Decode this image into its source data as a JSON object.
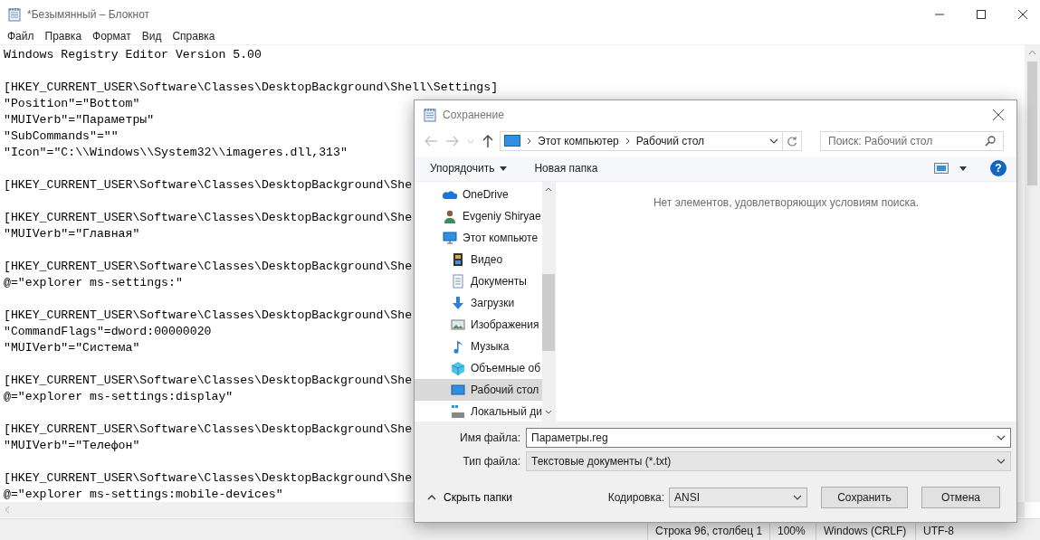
{
  "notepad": {
    "title": "*Безымянный – Блокнот",
    "menu": [
      "Файл",
      "Правка",
      "Формат",
      "Вид",
      "Справка"
    ],
    "blocks": [
      [
        "Windows Registry Editor Version 5.00"
      ],
      [
        "[HKEY_CURRENT_USER\\Software\\Classes\\DesktopBackground\\Shell\\Settings]",
        "\"Position\"=\"Bottom\"",
        "\"MUIVerb\"=\"Параметры\"",
        "\"SubCommands\"=\"\"",
        "\"Icon\"=\"C:\\\\Windows\\\\System32\\\\imageres.dll,313\""
      ],
      [
        "[HKEY_CURRENT_USER\\Software\\Classes\\DesktopBackground\\She"
      ],
      [
        "[HKEY_CURRENT_USER\\Software\\Classes\\DesktopBackground\\She",
        "\"MUIVerb\"=\"Главная\""
      ],
      [
        "[HKEY_CURRENT_USER\\Software\\Classes\\DesktopBackground\\She",
        "@=\"explorer ms-settings:\""
      ],
      [
        "[HKEY_CURRENT_USER\\Software\\Classes\\DesktopBackground\\She",
        "\"CommandFlags\"=dword:00000020",
        "\"MUIVerb\"=\"Система\""
      ],
      [
        "[HKEY_CURRENT_USER\\Software\\Classes\\DesktopBackground\\She",
        "@=\"explorer ms-settings:display\""
      ],
      [
        "[HKEY_CURRENT_USER\\Software\\Classes\\DesktopBackground\\She",
        "\"MUIVerb\"=\"Телефон\""
      ],
      [
        "[HKEY_CURRENT_USER\\Software\\Classes\\DesktopBackground\\She",
        "@=\"explorer ms-settings:mobile-devices\""
      ]
    ],
    "status_bar": [
      "Строка 96, столбец 1",
      "100%",
      "Windows (CRLF)",
      "UTF-8"
    ]
  },
  "dialog": {
    "title": "Сохранение",
    "breadcrumb": [
      "Этот компьютер",
      "Рабочий стол"
    ],
    "search": {
      "placeholder": "Поиск: Рабочий стол"
    },
    "toolbar": [
      "Упорядочить",
      "Новая папка"
    ],
    "help": "?",
    "nav": [
      {
        "label": "OneDrive",
        "kind": "cloud",
        "selected": false
      },
      {
        "label": "Evgeniy Shiryae",
        "kind": "user",
        "selected": false
      },
      {
        "label": "Этот компьюте",
        "kind": "computer",
        "selected": false,
        "children": [
          {
            "label": "Видео",
            "kind": "video",
            "selected": false
          },
          {
            "label": "Документы",
            "kind": "documents",
            "selected": false
          },
          {
            "label": "Загрузки",
            "kind": "downloads",
            "selected": false
          },
          {
            "label": "Изображения",
            "kind": "pictures",
            "selected": false
          },
          {
            "label": "Музыка",
            "kind": "music",
            "selected": false
          },
          {
            "label": "Объемные об",
            "kind": "objects",
            "selected": false
          },
          {
            "label": "Рабочий стол",
            "kind": "desktop",
            "selected": true
          },
          {
            "label": "Локальный ди",
            "kind": "drive",
            "selected": false
          }
        ]
      }
    ],
    "empty_message": "Нет элементов, удовлетворяющих условиям поиска.",
    "filename": {
      "label": "Имя файла:",
      "value": "Параметры.reg"
    },
    "filetype": {
      "label": "Тип файла:",
      "value": "Текстовые документы (*.txt)"
    },
    "hide_folders": "Скрыть папки",
    "encoding": {
      "label": "Кодировка:",
      "value": "ANSI"
    },
    "buttons": [
      "Сохранить",
      "Отмена"
    ]
  }
}
